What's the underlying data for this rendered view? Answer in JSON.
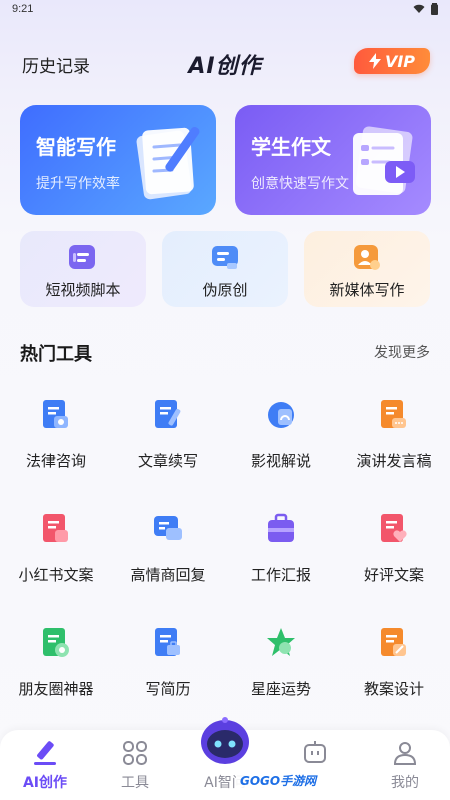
{
  "status_bar": {
    "time": "9:21"
  },
  "header": {
    "history": "历史记录",
    "title": "AI创作",
    "vip": "VIP"
  },
  "feature_cards": [
    {
      "title": "智能写作",
      "subtitle": "提升写作效率"
    },
    {
      "title": "学生作文",
      "subtitle": "创意快速写作文"
    }
  ],
  "sub_cards": [
    {
      "label": "短视频脚本"
    },
    {
      "label": "伪原创"
    },
    {
      "label": "新媒体写作"
    }
  ],
  "section": {
    "title": "热门工具",
    "more": "发现更多"
  },
  "tools": [
    {
      "label": "法律咨询"
    },
    {
      "label": "文章续写"
    },
    {
      "label": "影视解说"
    },
    {
      "label": "演讲发言稿"
    },
    {
      "label": "小红书文案"
    },
    {
      "label": "高情商回复"
    },
    {
      "label": "工作汇报"
    },
    {
      "label": "好评文案"
    },
    {
      "label": "朋友圈神器"
    },
    {
      "label": "写简历"
    },
    {
      "label": "星座运势"
    },
    {
      "label": "教案设计"
    }
  ],
  "bottom_nav": [
    {
      "label": "AI创作"
    },
    {
      "label": "工具"
    },
    {
      "label": "AI智问"
    },
    {
      "label": ""
    },
    {
      "label": "我的"
    }
  ],
  "watermark": {
    "text": "GOGO手游网"
  },
  "colors": {
    "accent": "#6b4cf6",
    "card_blue": "#3f6dff",
    "card_purple": "#7a5cf4",
    "vip_orange": "#ff6a3a"
  }
}
